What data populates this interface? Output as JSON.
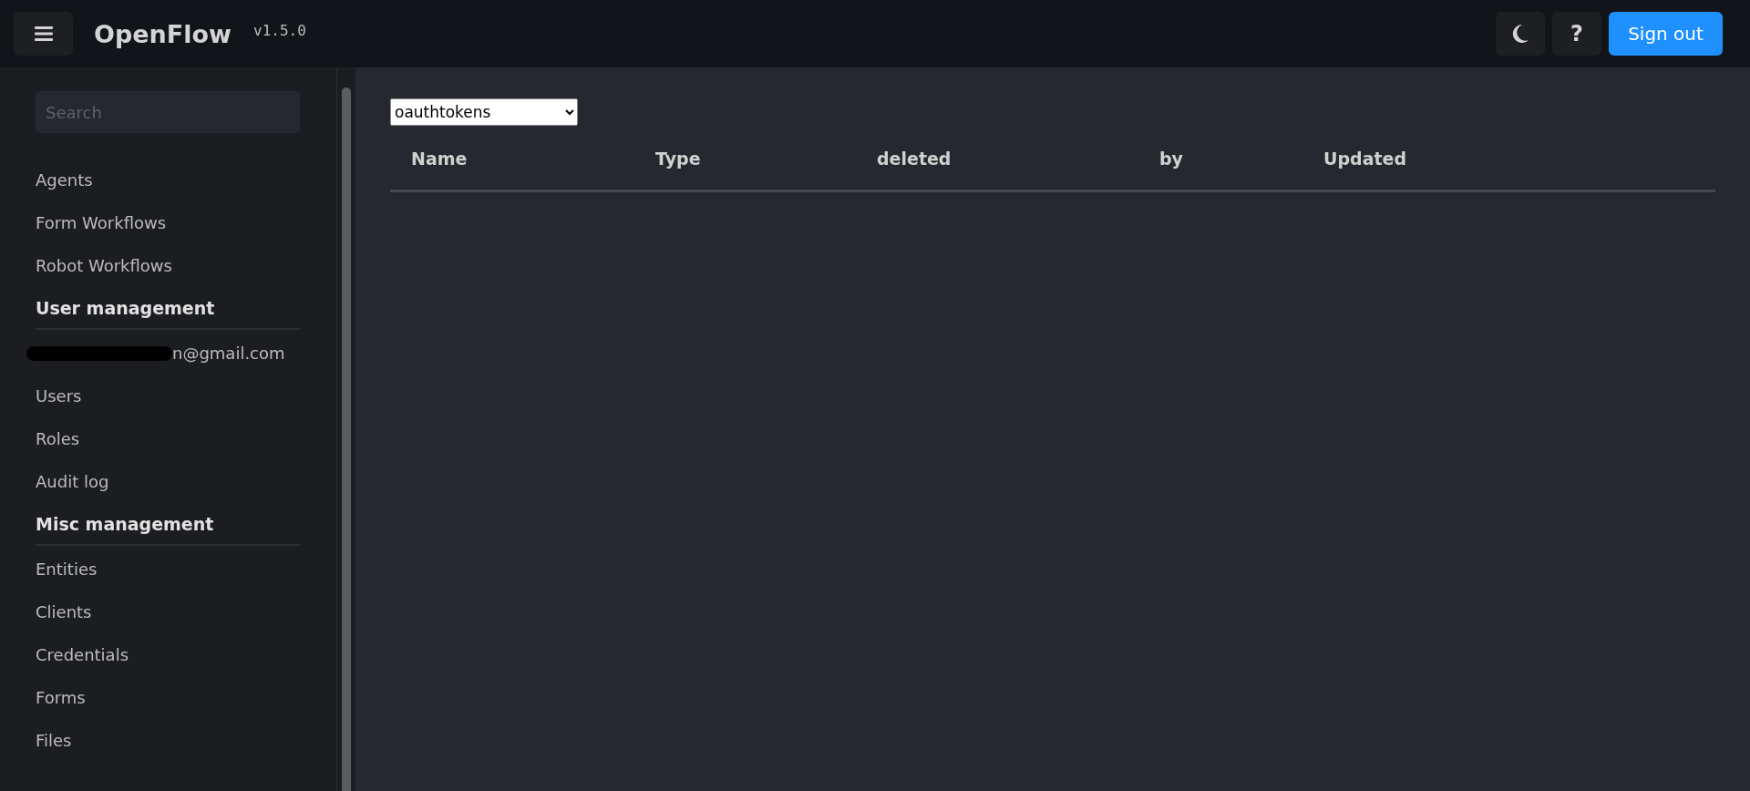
{
  "header": {
    "title": "OpenFlow",
    "version": "v1.5.0",
    "help_label": "?",
    "sign_out": "Sign out"
  },
  "sidebar": {
    "search": {
      "placeholder": "Search"
    },
    "items": [
      {
        "kind": "link",
        "label": "Agents"
      },
      {
        "kind": "link",
        "label": "Form Workflows"
      },
      {
        "kind": "link",
        "label": "Robot Workflows"
      },
      {
        "kind": "heading",
        "label": "User management"
      },
      {
        "kind": "redacted",
        "label": "n@gmail.com"
      },
      {
        "kind": "link",
        "label": "Users"
      },
      {
        "kind": "link",
        "label": "Roles"
      },
      {
        "kind": "link",
        "label": "Audit log"
      },
      {
        "kind": "heading",
        "label": "Misc management"
      },
      {
        "kind": "link",
        "label": "Entities"
      },
      {
        "kind": "link",
        "label": "Clients"
      },
      {
        "kind": "link",
        "label": "Credentials"
      },
      {
        "kind": "link",
        "label": "Forms"
      },
      {
        "kind": "link",
        "label": "Files"
      }
    ]
  },
  "main": {
    "collection_select": {
      "value": "oauthtokens"
    },
    "table": {
      "columns": [
        "Name",
        "Type",
        "deleted",
        "by",
        "Updated"
      ]
    }
  }
}
